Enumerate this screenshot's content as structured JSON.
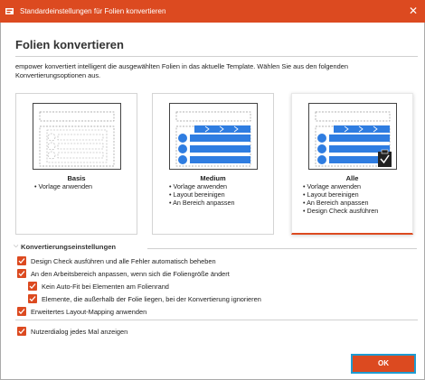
{
  "window": {
    "title": "Standardeinstellungen für Folien konvertieren",
    "close_glyph": "✕",
    "icon": "app-icon"
  },
  "dialog": {
    "heading": "Folien konvertieren",
    "description": "empower konvertiert intelligent die ausgewählten Folien in das aktuelle Template. Wählen Sie aus den folgenden Konvertierungsoptionen aus."
  },
  "cards": [
    {
      "title": "Basis",
      "bullets": [
        "• Vorlage anwenden"
      ],
      "selected": false
    },
    {
      "title": "Medium",
      "bullets": [
        "• Vorlage anwenden",
        "• Layout bereinigen",
        "• An Bereich anpassen"
      ],
      "selected": false
    },
    {
      "title": "Alle",
      "bullets": [
        "• Vorlage anwenden",
        "• Layout bereinigen",
        "• An Bereich anpassen",
        "• Design Check ausführen"
      ],
      "selected": true
    }
  ],
  "settings": {
    "section_title": "Konvertierungseinstellungen",
    "options": [
      {
        "label": "Design Check ausführen und alle Fehler automatisch beheben",
        "checked": true
      },
      {
        "label": "An den Arbeitsbereich anpassen, wenn sich die Foliengröße ändert",
        "checked": true
      },
      {
        "label": "Kein Auto-Fit bei Elementen am Folienrand",
        "checked": true
      },
      {
        "label": "Elemente, die außerhalb der Folie liegen, bei der Konvertierung ignorieren",
        "checked": true
      },
      {
        "label": "Erweitertes Layout-Mapping anwenden",
        "checked": true
      }
    ],
    "show_dialog": {
      "label": "Nutzerdialog jedes Mal anzeigen",
      "checked": true
    }
  },
  "buttons": {
    "ok_label": "OK"
  },
  "colors": {
    "accent": "#dc4a20",
    "thumb_blue": "#2f7de1",
    "focus_ring": "#1f9bd1"
  }
}
